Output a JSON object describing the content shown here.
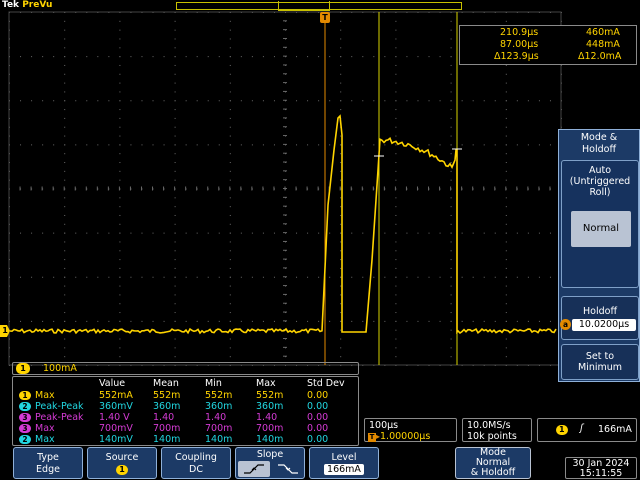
{
  "header": {
    "brand_prefix": "Tek",
    "brand_mode": "PreVu"
  },
  "trigger_marker": "T",
  "channel_marker": "1",
  "cursors": {
    "row1": {
      "time": "210.9µs",
      "value": "460mA"
    },
    "row2": {
      "time": "87.00µs",
      "value": "448mA"
    },
    "row3": {
      "time": "Δ123.9µs",
      "value": "Δ12.0mA"
    }
  },
  "side_menu": {
    "title_line1": "Mode &",
    "title_line2": "Holdoff",
    "auto_line1": "Auto",
    "auto_line2": "(Untriggered",
    "auto_line3": "Roll)",
    "normal_label": "Normal",
    "holdoff_label": "Holdoff",
    "holdoff_knob": "a",
    "holdoff_value": "10.0200µs",
    "set_min_line1": "Set to",
    "set_min_line2": "Minimum"
  },
  "channel_scale": {
    "channel": "1",
    "value": "100mA"
  },
  "measurements": {
    "headers": [
      "Value",
      "Mean",
      "Min",
      "Max",
      "Std Dev"
    ],
    "rows": [
      {
        "ch": "1",
        "name": "Max",
        "color": "#ffd400",
        "values": [
          "552mA",
          "552m",
          "552m",
          "552m",
          "0.00"
        ]
      },
      {
        "ch": "2",
        "name": "Peak-Peak",
        "color": "#21d6e0",
        "values": [
          "360mV",
          "360m",
          "360m",
          "360m",
          "0.00"
        ]
      },
      {
        "ch": "3",
        "name": "Peak-Peak",
        "color": "#d43bd4",
        "values": [
          "1.40 V",
          "1.40",
          "1.40",
          "1.40",
          "0.00"
        ]
      },
      {
        "ch": "3",
        "name": "Max",
        "color": "#d43bd4",
        "values": [
          "700mV",
          "700m",
          "700m",
          "700m",
          "0.00"
        ]
      },
      {
        "ch": "2",
        "name": "Max",
        "color": "#21d6e0",
        "values": [
          "140mV",
          "140m",
          "140m",
          "140m",
          "0.00"
        ]
      }
    ]
  },
  "timebase": {
    "scale": "100µs",
    "position": "1.00000µs",
    "sample_rate": "10.0MS/s",
    "record_length": "10k points"
  },
  "trigger_info": {
    "channel": "1",
    "slope_symbol": "ʃ",
    "level": "166mA"
  },
  "bottom_menu": {
    "type": {
      "label": "Type",
      "value": "Edge"
    },
    "source": {
      "label": "Source",
      "value": "1"
    },
    "coupling": {
      "label": "Coupling",
      "value": "DC"
    },
    "slope": {
      "label": "Slope"
    },
    "level": {
      "label": "Level",
      "value": "166mA"
    },
    "mode": {
      "line1": "Mode",
      "line2": "Normal",
      "line3": "& Holdoff"
    }
  },
  "clock": {
    "date": "30 Jan  2024",
    "time": "15:11:55"
  },
  "colors": {
    "ch1": "#ffd400",
    "ch2": "#21d6e0",
    "ch3": "#d43bd4",
    "menu_bg": "#1c3a66",
    "trigger": "#e38a00"
  }
}
